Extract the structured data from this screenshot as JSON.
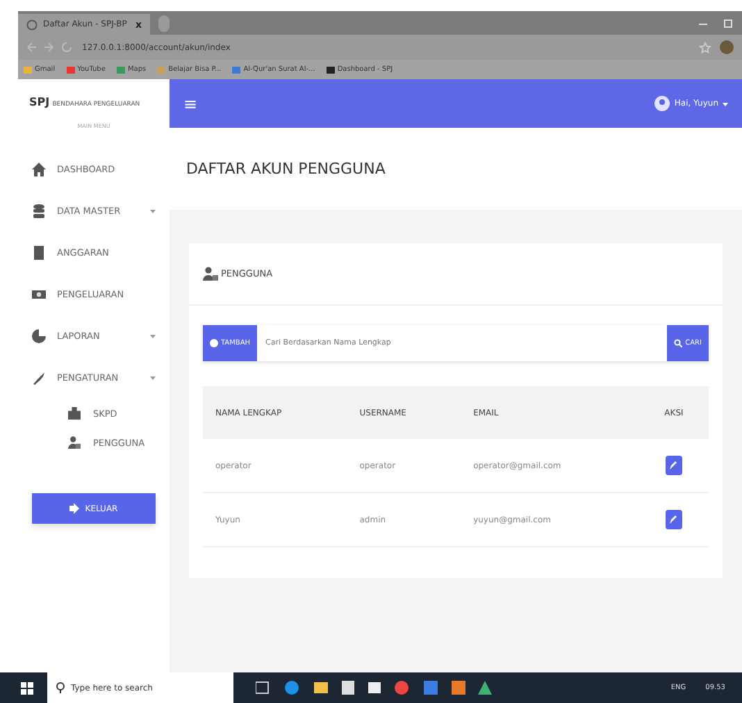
{
  "browser": {
    "tab_title": "Daftar Akun - SPJ-BP",
    "tab_close": "x",
    "url": "127.0.0.1:8000/account/akun/index",
    "bookmarks": [
      "Gmail",
      "YouTube",
      "Maps",
      "Belajar Bisa P...",
      "Al-Qur'an Surat Al-...",
      "Dashboard - SPJ"
    ]
  },
  "sidebar": {
    "brand": "SPJ",
    "brand_sub": "BENDAHARA PENGELUARAN",
    "section": "MAIN MENU",
    "items": [
      {
        "label": "DASHBOARD",
        "has_caret": false
      },
      {
        "label": "DATA MASTER",
        "has_caret": true
      },
      {
        "label": "ANGGARAN",
        "has_caret": false
      },
      {
        "label": "PENGELUARAN",
        "has_caret": false
      },
      {
        "label": "LAPORAN",
        "has_caret": true
      },
      {
        "label": "PENGATURAN",
        "has_caret": true,
        "children": [
          {
            "label": "SKPD"
          },
          {
            "label": "PENGGUNA"
          }
        ]
      }
    ],
    "logout": "KELUAR"
  },
  "header": {
    "menu": "≡",
    "user": "Hai, Yuyun"
  },
  "page_title": "DAFTAR AKUN PENGGUNA",
  "card": {
    "title": "PENGGUNA",
    "add_button": "TAMBAH",
    "search_placeholder": "Cari Berdasarkan Nama Lengkap",
    "search_button": "CARI",
    "columns": [
      "NAMA LENGKAP",
      "USERNAME",
      "EMAIL",
      "AKSI"
    ],
    "rows": [
      {
        "name": "operator",
        "username": "operator",
        "email": "operator@gmail.com"
      },
      {
        "name": "Yuyun",
        "username": "admin",
        "email": "yuyun@gmail.com"
      }
    ]
  },
  "taskbar": {
    "search": "Type here to search",
    "lang": "ENG",
    "time": "09.53"
  }
}
